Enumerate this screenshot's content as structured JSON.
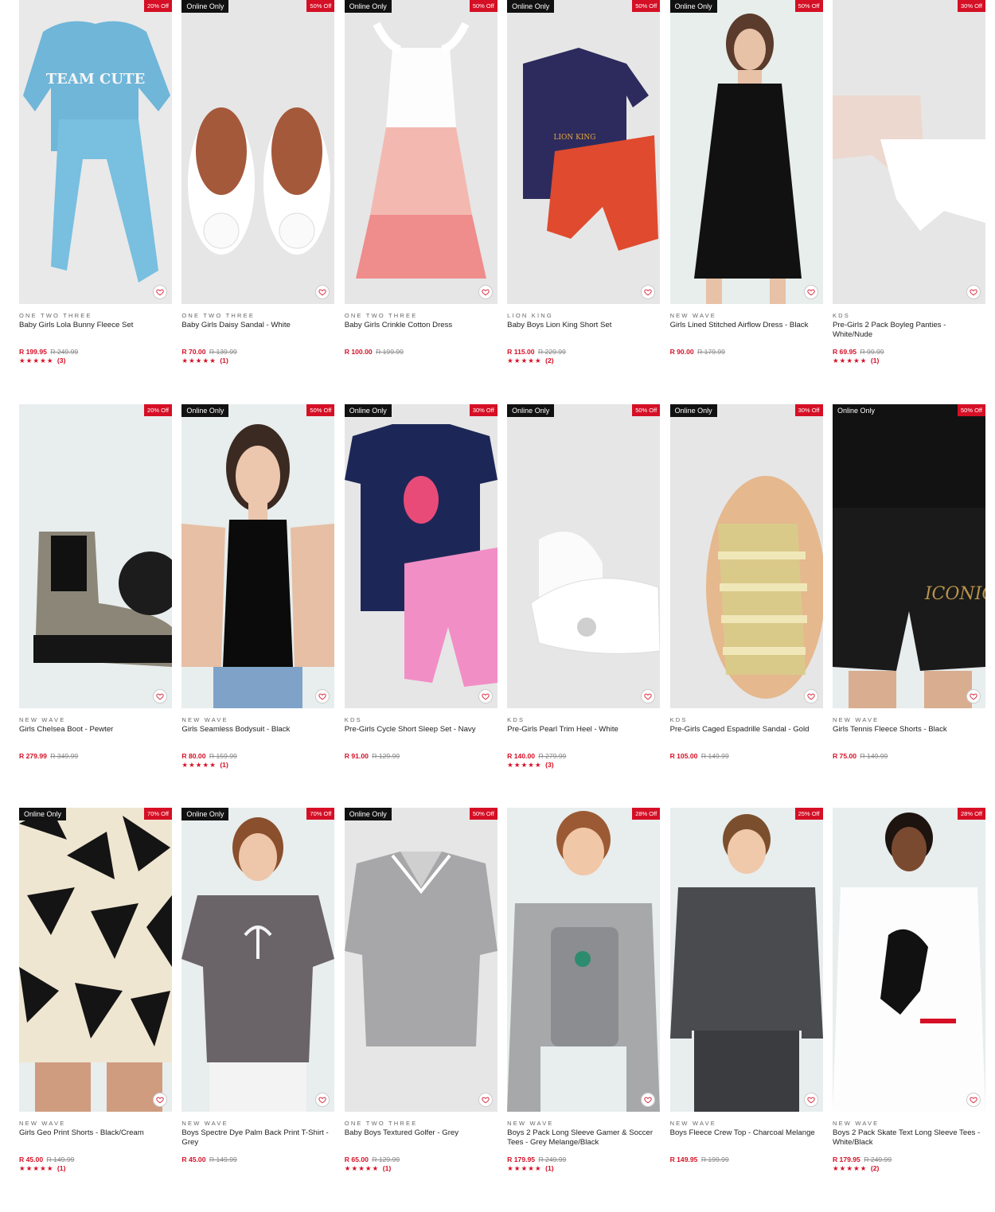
{
  "colors": {
    "accent": "#d50f25",
    "badge_online_bg": "#111111"
  },
  "products": [
    {
      "online": "",
      "discount": "20% Off",
      "brand": "ONE TWO THREE",
      "name": "Baby Girls Lola Bunny Fleece Set",
      "price": "R 199.95",
      "was": "R 249.99",
      "stars": "★★★★★",
      "reviews": "(3)",
      "bg": "#e9e9e9",
      "art": "bluefleece"
    },
    {
      "online": "Online Only",
      "discount": "50% Off",
      "brand": "ONE TWO THREE",
      "name": "Baby Girls Daisy Sandal - White",
      "price": "R 70.00",
      "was": "R 139.99",
      "stars": "★★★★★",
      "reviews": "(1)",
      "bg": "#e6e6e6",
      "art": "sandals-white"
    },
    {
      "online": "Online Only",
      "discount": "50% Off",
      "brand": "ONE TWO THREE",
      "name": "Baby Girls Crinkle Cotton Dress",
      "price": "R 100.00",
      "was": "R 199.99",
      "stars": "",
      "reviews": "",
      "bg": "#e6e6e6",
      "art": "pinkdress"
    },
    {
      "online": "Online Only",
      "discount": "50% Off",
      "brand": "LION KING",
      "name": "Baby Boys Lion King Short Set",
      "price": "R 115.00",
      "was": "R 229.99",
      "stars": "★★★★★",
      "reviews": "(2)",
      "bg": "#e6e6e6",
      "art": "lionking"
    },
    {
      "online": "Online Only",
      "discount": "50% Off",
      "brand": "NEW WAVE",
      "name": "Girls Lined Stitched Airflow Dress - Black",
      "price": "R 90.00",
      "was": "R 179.99",
      "stars": "",
      "reviews": "",
      "bg": "#e7eeec",
      "art": "blackdress"
    },
    {
      "online": "",
      "discount": "30% Off",
      "brand": "KDS",
      "name": "Pre-Girls 2 Pack Boyleg Panties - White/Nude",
      "price": "R 69.95",
      "was": "R 99.99",
      "stars": "★★★★★",
      "reviews": "(1)",
      "bg": "#e6e6e6",
      "art": "panties"
    },
    {
      "online": "",
      "discount": "20% Off",
      "brand": "NEW WAVE",
      "name": "Girls Chelsea Boot - Pewter",
      "price": "R 279.99",
      "was": "R 349.99",
      "stars": "",
      "reviews": "",
      "bg": "#e8eded",
      "art": "boots"
    },
    {
      "online": "Online Only",
      "discount": "50% Off",
      "brand": "NEW WAVE",
      "name": "Girls Seamless Bodysuit - Black",
      "price": "R 80.00",
      "was": "R 159.99",
      "stars": "★★★★★",
      "reviews": "(1)",
      "bg": "#e8eded",
      "art": "bodysuit"
    },
    {
      "online": "Online Only",
      "discount": "30% Off",
      "brand": "KDS",
      "name": "Pre-Girls Cycle Short Sleep Set - Navy",
      "price": "R 91.00",
      "was": "R 129.99",
      "stars": "",
      "reviews": "",
      "bg": "#e6e6e6",
      "art": "navysleep"
    },
    {
      "online": "Online Only",
      "discount": "50% Off",
      "brand": "KDS",
      "name": "Pre-Girls Pearl Trim Heel - White",
      "price": "R 140.00",
      "was": "R 279.99",
      "stars": "★★★★★",
      "reviews": "(3)",
      "bg": "#e6e6e6",
      "art": "whiteheels"
    },
    {
      "online": "Online Only",
      "discount": "30% Off",
      "brand": "KDS",
      "name": "Pre-Girls Caged Espadrille Sandal - Gold",
      "price": "R 105.00",
      "was": "R 149.99",
      "stars": "",
      "reviews": "",
      "bg": "#e6e6e6",
      "art": "goldsandal"
    },
    {
      "online": "Online Only",
      "discount": "50% Off",
      "brand": "NEW WAVE",
      "name": "Girls Tennis Fleece Shorts - Black",
      "price": "R 75.00",
      "was": "R 149.99",
      "stars": "",
      "reviews": "",
      "bg": "#e8eded",
      "art": "blackshorts"
    },
    {
      "online": "Online Only",
      "discount": "70% Off",
      "brand": "NEW WAVE",
      "name": "Girls Geo Print Shorts - Black/Cream",
      "price": "R 45.00",
      "was": "R 149.99",
      "stars": "★★★★★",
      "reviews": "(1)",
      "bg": "#e8eded",
      "art": "geoshorts"
    },
    {
      "online": "Online Only",
      "discount": "70% Off",
      "brand": "NEW WAVE",
      "name": "Boys Spectre Dye Palm Back Print T-Shirt - Grey",
      "price": "R 45.00",
      "was": "R 149.99",
      "stars": "",
      "reviews": "",
      "bg": "#e8eded",
      "art": "tiedyetee"
    },
    {
      "online": "Online Only",
      "discount": "50% Off",
      "brand": "ONE TWO THREE",
      "name": "Baby Boys Textured Golfer - Grey",
      "price": "R 65.00",
      "was": "R 129.99",
      "stars": "★★★★★",
      "reviews": "(1)",
      "bg": "#e6e6e6",
      "art": "golfer"
    },
    {
      "online": "",
      "discount": "28% Off",
      "brand": "NEW WAVE",
      "name": "Boys 2 Pack Long Sleeve Gamer & Soccer Tees - Grey Melange/Black",
      "price": "R 179.95",
      "was": "R 249.99",
      "stars": "★★★★★",
      "reviews": "(1)",
      "bg": "#e8eded",
      "art": "gamertee"
    },
    {
      "online": "",
      "discount": "25% Off",
      "brand": "NEW WAVE",
      "name": "Boys Fleece Crew Top - Charcoal Melange",
      "price": "R 149.95",
      "was": "R 199.99",
      "stars": "",
      "reviews": "",
      "bg": "#e8eded",
      "art": "charcoal"
    },
    {
      "online": "",
      "discount": "28% Off",
      "brand": "NEW WAVE",
      "name": "Boys 2 Pack Skate Text Long Sleeve Tees - White/Black",
      "price": "R 179.95",
      "was": "R 249.99",
      "stars": "★★★★★",
      "reviews": "(2)",
      "bg": "#e8eded",
      "art": "skatetee"
    }
  ]
}
